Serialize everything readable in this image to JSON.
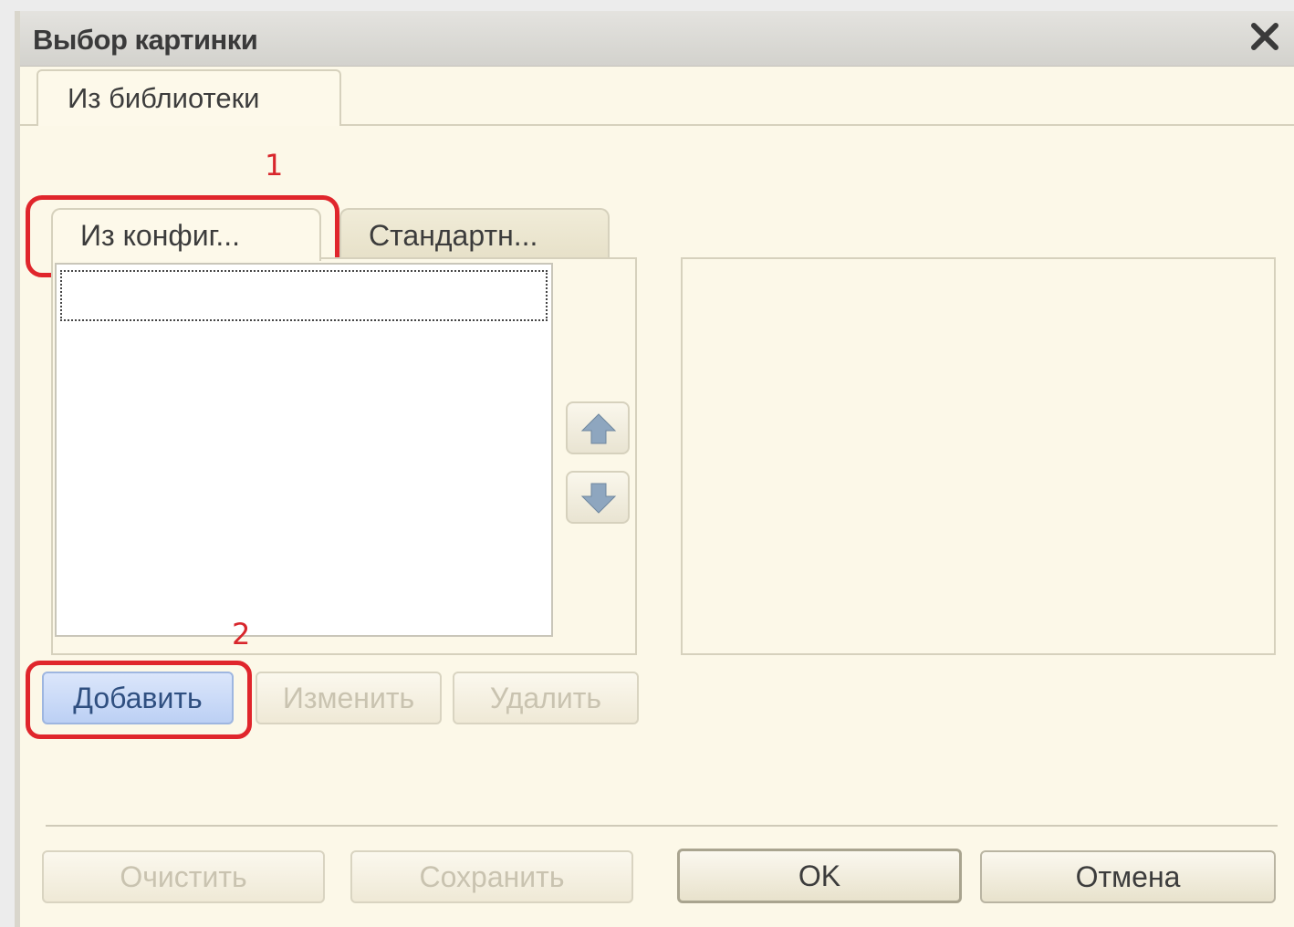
{
  "dialog": {
    "title": "Выбор картинки",
    "close_icon": "close-icon"
  },
  "outer_tabs": [
    {
      "label": "Из библиотеки",
      "active": true
    }
  ],
  "inner_tabs": [
    {
      "label": "Из конфиг...",
      "active": true
    },
    {
      "label": "Стандартн...",
      "active": false
    }
  ],
  "annotations": {
    "marker_1": "1",
    "marker_2": "2",
    "color": "#e0262c"
  },
  "list": {
    "items": [
      ""
    ]
  },
  "order_buttons": {
    "up_icon": "arrow-up-icon",
    "down_icon": "arrow-down-icon"
  },
  "list_actions": {
    "add": "Добавить",
    "edit": "Изменить",
    "delete": "Удалить"
  },
  "footer": {
    "clear": "Очистить",
    "save": "Сохранить",
    "ok": "OK",
    "cancel": "Отмена"
  }
}
